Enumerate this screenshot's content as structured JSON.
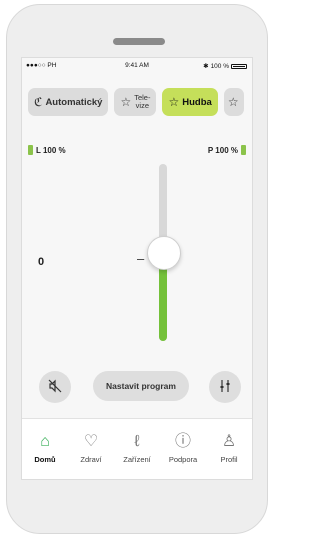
{
  "status_bar": {
    "carrier": "●●●○○ PH ",
    "time": "9:41 AM",
    "battery": "100 %"
  },
  "programs": [
    {
      "label": "Automatický",
      "icon": "ear-icon",
      "active": false
    },
    {
      "label_line1": "Tele-",
      "label_line2": "vize",
      "icon": "star-icon",
      "active": false
    },
    {
      "label": "Hudba",
      "icon": "star-icon",
      "active": true
    },
    {
      "label": "",
      "icon": "star-icon",
      "active": false
    }
  ],
  "battery": {
    "left": "L 100 %",
    "right": "P 100 %"
  },
  "volume": {
    "value": "0",
    "level_fraction": 0.5
  },
  "controls": {
    "program_button": "Nastavit program"
  },
  "tabs": [
    {
      "label": "Domů",
      "icon": "home-icon",
      "active": true
    },
    {
      "label": "Zdraví",
      "icon": "heart-icon",
      "active": false
    },
    {
      "label": "Zařízení",
      "icon": "hearing-aid-icon",
      "active": false
    },
    {
      "label": "Podpora",
      "icon": "help-icon",
      "active": false
    },
    {
      "label": "Profil",
      "icon": "profile-icon",
      "active": false
    }
  ],
  "colors": {
    "accent": "#c5df5a",
    "fill_green": "#74c13a",
    "tab_active": "#3bb15a"
  }
}
